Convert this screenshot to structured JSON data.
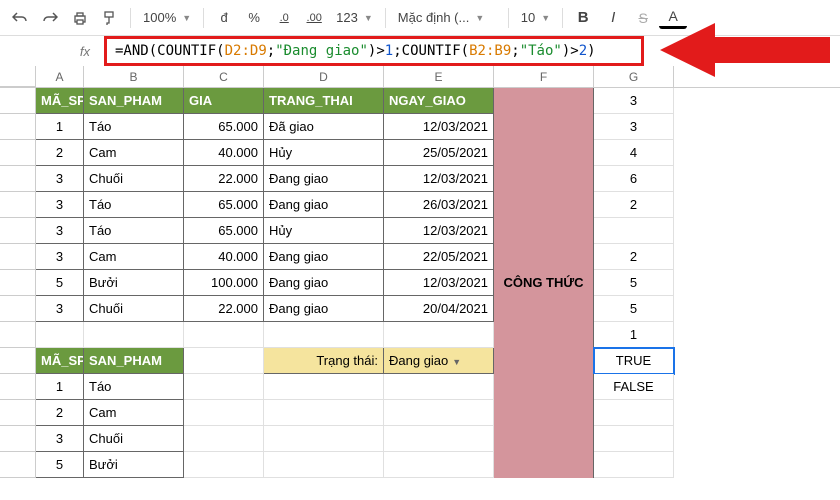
{
  "toolbar": {
    "zoom": "100%",
    "currency": "đ",
    "percent": "%",
    "dec_dec": ".0",
    "dec_inc": ".00",
    "format123": "123",
    "font_style": "Mặc định (...",
    "font_size": "10",
    "bold": "B",
    "italic": "I",
    "strike": "S",
    "text_color": "A"
  },
  "formula": {
    "fx": "fx",
    "parts": {
      "p1": "=AND",
      "p2": "(",
      "p3": "COUNTIF",
      "p4": "(",
      "p5": "D2:D9",
      "p6": ";",
      "p7": "\"Đang giao\"",
      "p8": ")>",
      "p9": "1",
      "p10": ";",
      "p11": "COUNTIF",
      "p12": "(",
      "p13": "B2:B9",
      "p14": ";",
      "p15": "\"Táo\"",
      "p16": ")>",
      "p17": "2",
      "p18": ")"
    }
  },
  "cols": [
    "A",
    "B",
    "C",
    "D",
    "E",
    "F",
    "G"
  ],
  "headers": {
    "ma_sp": "MÃ_SP",
    "san_pham": "SAN_PHAM",
    "gia": "GIA",
    "trang_thai": "TRANG_THAI",
    "ngay_giao": "NGAY_GIAO"
  },
  "g_top": [
    "3",
    "3",
    "4",
    "6",
    "2"
  ],
  "rows": [
    {
      "a": "1",
      "b": "Táo",
      "c": "65.000",
      "d": "Đã giao",
      "e": "12/03/2021",
      "g": ""
    },
    {
      "a": "2",
      "b": "Cam",
      "c": "40.000",
      "d": "Hủy",
      "e": "25/05/2021",
      "g": ""
    },
    {
      "a": "3",
      "b": "Chuối",
      "c": "22.000",
      "d": "Đang giao",
      "e": "12/03/2021",
      "g": ""
    },
    {
      "a": "3",
      "b": "Táo",
      "c": "65.000",
      "d": "Đang giao",
      "e": "26/03/2021",
      "g": ""
    },
    {
      "a": "3",
      "b": "Táo",
      "c": "65.000",
      "d": "Hủy",
      "e": "12/03/2021",
      "g": ""
    },
    {
      "a": "3",
      "b": "Cam",
      "c": "40.000",
      "d": "Đang giao",
      "e": "22/05/2021",
      "g": "2"
    },
    {
      "a": "5",
      "b": "Bưởi",
      "c": "100.000",
      "d": "Đang giao",
      "e": "12/03/2021",
      "g": "5"
    },
    {
      "a": "3",
      "b": "Chuối",
      "c": "22.000",
      "d": "Đang giao",
      "e": "20/04/2021",
      "g": "5"
    }
  ],
  "g_after": [
    "1"
  ],
  "cong_thuc": "CÔNG THỨC",
  "filter": {
    "label": "Trạng thái:",
    "value": "Đang giao"
  },
  "result": {
    "true": "TRUE",
    "false": "FALSE"
  },
  "list2": [
    {
      "a": "1",
      "b": "Táo"
    },
    {
      "a": "2",
      "b": "Cam"
    },
    {
      "a": "3",
      "b": "Chuối"
    },
    {
      "a": "5",
      "b": "Bưởi"
    }
  ]
}
